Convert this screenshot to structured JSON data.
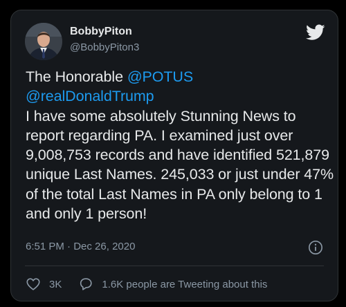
{
  "author": {
    "name": "BobbyPiton",
    "handle": "@BobbyPiton3"
  },
  "tweet": {
    "line1_prefix": "The Honorable ",
    "mention1": "@POTUS",
    "mention2": "@realDonaldTrump",
    "body": "I have some absolutely Stunning News to report regarding PA.  I examined just over 9,008,753 records and have identified 521,879 unique Last Names.  245,033 or just under 47% of the total Last Names in PA only belong to 1 and only 1 person!"
  },
  "meta": {
    "time": "6:51 PM",
    "separator": " · ",
    "date": "Dec 26, 2020"
  },
  "actions": {
    "likes": "3K",
    "replies_text": "1.6K people are Tweeting about this"
  },
  "icons": {
    "brand": "twitter-bird-icon",
    "info": "info-icon",
    "like": "heart-icon",
    "reply": "speech-bubble-icon"
  },
  "colors": {
    "background": "#000000",
    "card": "#15181c",
    "text": "#e7e9ea",
    "secondary": "#8b98a5",
    "link": "#1d9bf0"
  }
}
